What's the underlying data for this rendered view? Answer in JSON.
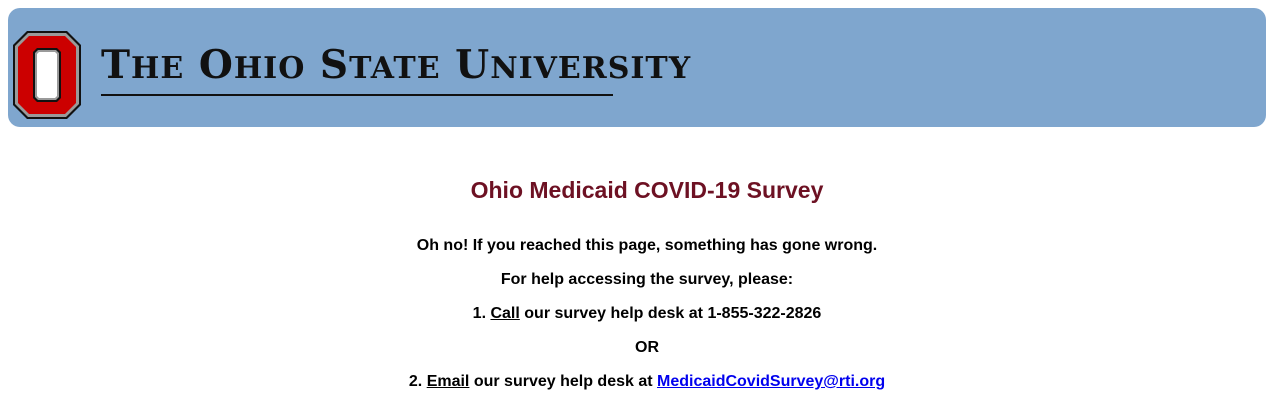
{
  "header": {
    "logo_icon": "block-o-logo-icon",
    "wordmark": {
      "the_initial": "T",
      "the_rest": "HE",
      "ohio_initial": "O",
      "ohio_rest": "HIO",
      "state_initial": "S",
      "state_rest": "TATE",
      "university_initial": "U",
      "university_rest": "NIVERSITY"
    },
    "background_color": "#7fa6ce"
  },
  "main": {
    "title": "Ohio Medicaid COVID-19 Survey",
    "title_color": "#6d1123",
    "error_message": "Oh no! If you reached this page, something has gone wrong.",
    "help_intro": "For help accessing the survey, please:",
    "option1": {
      "number": "1.",
      "action": "Call",
      "text": "our survey help desk at 1-855-322-2826"
    },
    "or_label": "OR",
    "option2": {
      "number": "2.",
      "action": "Email",
      "text": "our survey help desk at",
      "email": "MedicaidCovidSurvey@rti.org"
    }
  }
}
